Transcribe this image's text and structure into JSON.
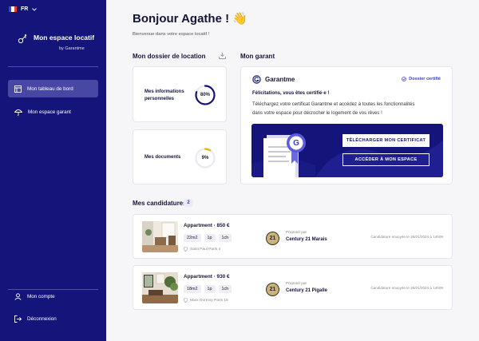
{
  "lang": {
    "code": "FR"
  },
  "brand": {
    "title": "Mon espace locatif",
    "subtitle": "by Garantme"
  },
  "nav": {
    "dashboard": "Mon tableau de bord",
    "guarantor_space": "Mon espace garant",
    "account": "Mon compte",
    "logout": "Déconnexion"
  },
  "header": {
    "title": "Bonjour Agathe ! 👋",
    "subtitle": "Bienvenue dans votre espace locatif !"
  },
  "dossier": {
    "title": "Mon dossier de location",
    "items": [
      {
        "label_line1": "Mes informations",
        "label_line2": "personnelles",
        "value": "80%",
        "progress": 0.8
      },
      {
        "label": "Mes documents",
        "value": "9%",
        "progress": 0.09
      }
    ]
  },
  "garant": {
    "section_title": "Mon garant",
    "brand": "Garantme",
    "badge": "Dossier certifié",
    "congrats": "Félicitations, vous êtes certifié·e !",
    "desc_line1": "Téléchargez votre certificat Garantme et accédez à toutes les fonctionnalités",
    "desc_line2": "dans votre espace pour décrocher le logement de vos rêves !",
    "download_btn": "TÉLÉCHARGER MON CERTIFICAT",
    "access_btn": "ACCÉDER À MON ESPACE",
    "seal_letter": "G"
  },
  "candidatures": {
    "title": "Mes candidatures",
    "count": "2",
    "items": [
      {
        "title": "Appartment · 850 €",
        "area": "22m2",
        "bed": "1p",
        "rooms": "1ch",
        "location": "Saint Paul Paris 4",
        "proposed_by": "Proposé par",
        "agency": "Century 21 Marais",
        "agency_logo": "21",
        "sent": "Candidature envoyée le 26/01/2024 à 14h09"
      },
      {
        "title": "Appartment · 930 €",
        "area": "18m2",
        "bed": "1p",
        "rooms": "1ch",
        "location": "Marx Dormoy Paris 18",
        "proposed_by": "Proposé par",
        "agency": "Century 21 Pigalle",
        "agency_logo": "21",
        "sent": "Candidature envoyée le 26/01/2024 à 14h09"
      }
    ]
  },
  "colors": {
    "sidebar": "#14147a",
    "accent": "#3b3bd8",
    "gauge_track": "#e9e9ef",
    "gauge_low": "#f0b400"
  }
}
